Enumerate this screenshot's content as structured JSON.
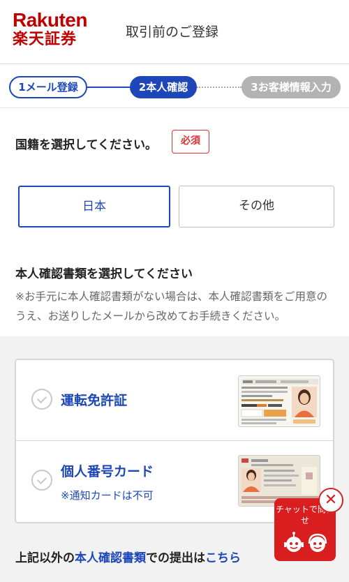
{
  "header": {
    "logo_en": "Rakuten",
    "logo_jp": "楽天証券",
    "title": "取引前のご登録"
  },
  "steps": [
    {
      "label": "1メール登録",
      "state": "done"
    },
    {
      "label": "2本人確認",
      "state": "current"
    },
    {
      "label": "3お客様情報入力",
      "state": "todo"
    }
  ],
  "nationality": {
    "question": "国籍を選択してください。",
    "required_badge": "必須",
    "options": [
      {
        "label": "日本",
        "selected": true
      },
      {
        "label": "その他",
        "selected": false
      }
    ]
  },
  "documents": {
    "heading": "本人確認書類を選択してください",
    "note": "※お手元に本人確認書類がない場合は、本人確認書類をご用意のうえ、お送りしたメールから改めてお手続きください。",
    "items": [
      {
        "title": "運転免許証",
        "subtitle": "",
        "icon": "drivers-license-image"
      },
      {
        "title": "個人番号カード",
        "subtitle": "※通知カードは不可",
        "icon": "my-number-card-image"
      }
    ]
  },
  "footer_text": {
    "prefix": "上記以外の",
    "link1": "本人確認書類",
    "middle": "での提出は",
    "link2": "こちら"
  },
  "chat": {
    "label": "チャットで問合せ",
    "close": "✕"
  },
  "colors": {
    "brand_red": "#bf0000",
    "primary_blue": "#1d47b8",
    "inactive_gray": "#b3b3b3",
    "chat_red": "#d81e1e"
  }
}
